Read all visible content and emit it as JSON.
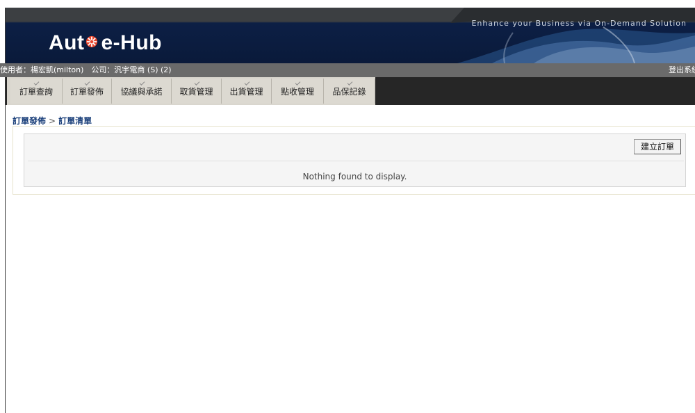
{
  "header": {
    "logo": {
      "text_left": "Aut",
      "text_right": "e-Hub"
    },
    "tagline": "Enhance your Business via On-Demand Solution"
  },
  "userbar": {
    "user_info": "使用者：楊宏凱(milton)　公司：汎宇電商 (S) (2)",
    "logout": "登出系統"
  },
  "nav": {
    "tabs": [
      {
        "label": "訂單查詢"
      },
      {
        "label": "訂單發佈"
      },
      {
        "label": "協議與承諾"
      },
      {
        "label": "取貨管理"
      },
      {
        "label": "出貨管理"
      },
      {
        "label": "點收管理"
      },
      {
        "label": "品保記錄"
      }
    ]
  },
  "breadcrumb": {
    "parent": "訂單發佈",
    "separator": ">",
    "current": "訂單清單"
  },
  "content": {
    "create_button": "建立訂單",
    "empty_message": "Nothing found to display."
  },
  "colors": {
    "header_bg": "#0a1a3a",
    "userbar_bg": "#6a6a6a",
    "nav_bg": "#262626",
    "tab_bg": "#dcd9d1",
    "breadcrumb": "#1a3f7a",
    "logo_star": "#e8452c"
  },
  "icons": {
    "logo_mark": "asterisk-star-icon",
    "tab_indicator": "chevron-down-icon"
  }
}
